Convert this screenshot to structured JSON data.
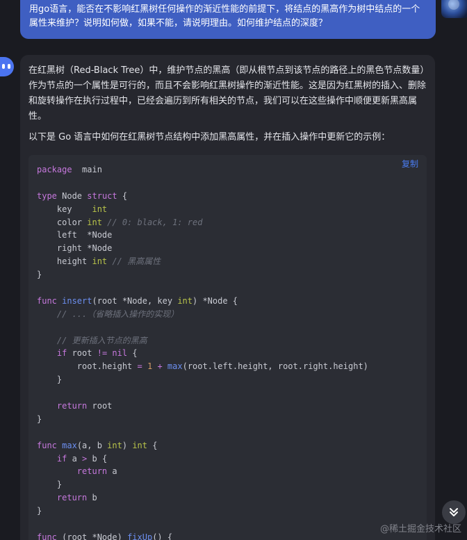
{
  "user": {
    "message": "用go语言，能否在不影响红黑树任何操作的渐近性能的前提下，将结点的黑高作为树中结点的一个属性来维护？说明如何做，如果不能，请说明理由。如何维护结点的深度？"
  },
  "assistant": {
    "paragraph1": "在红黑树（Red-Black Tree）中，维护节点的黑高（即从根节点到该节点的路径上的黑色节点数量）作为节点的一个属性是可行的，而且不会影响红黑树操作的渐近性能。这是因为红黑树的插入、删除和旋转操作在执行过程中，已经会遍历到所有相关的节点，我们可以在这些操作中顺便更新黑高属性。",
    "paragraph2": "以下是 Go 语言中如何在红黑树节点结构中添加黑高属性，并在插入操作中更新它的示例：",
    "copy_label": "复制",
    "code_lines": [
      [
        [
          "kw",
          "package"
        ],
        [
          "",
          "  main"
        ]
      ],
      [],
      [
        [
          "kw",
          "type"
        ],
        [
          "",
          " Node "
        ],
        [
          "kw",
          "struct"
        ],
        [
          "",
          " {"
        ]
      ],
      [
        [
          "",
          "    key    "
        ],
        [
          "ty",
          "int"
        ]
      ],
      [
        [
          "",
          "    color "
        ],
        [
          "ty",
          "int"
        ],
        [
          "cm",
          " // 0: black, 1: red"
        ]
      ],
      [
        [
          "",
          "    left  *Node"
        ]
      ],
      [
        [
          "",
          "    right *Node"
        ]
      ],
      [
        [
          "",
          "    height "
        ],
        [
          "ty",
          "int"
        ],
        [
          "cm",
          " // 黑高属性"
        ]
      ],
      [
        [
          "",
          "}"
        ]
      ],
      [],
      [
        [
          "kw",
          "func"
        ],
        [
          "fn",
          " insert"
        ],
        [
          "",
          "(root *Node, key "
        ],
        [
          "ty",
          "int"
        ],
        [
          "",
          ") *Node {"
        ]
      ],
      [
        [
          "cm",
          "    // ...（省略插入操作的实现）"
        ]
      ],
      [],
      [
        [
          "cm",
          "    // 更新插入节点的黑高"
        ]
      ],
      [
        [
          "",
          "    "
        ],
        [
          "kw",
          "if"
        ],
        [
          "",
          " root "
        ],
        [
          "op",
          "!="
        ],
        [
          "",
          " "
        ],
        [
          "kw",
          "nil"
        ],
        [
          "",
          " {"
        ]
      ],
      [
        [
          "",
          "        root.height "
        ],
        [
          "op",
          "="
        ],
        [
          "",
          " "
        ],
        [
          "num",
          "1"
        ],
        [
          "",
          " "
        ],
        [
          "op",
          "+"
        ],
        [
          "",
          " "
        ],
        [
          "fn",
          "max"
        ],
        [
          "",
          "(root.left.height, root.right.height)"
        ]
      ],
      [
        [
          "",
          "    }"
        ]
      ],
      [],
      [
        [
          "",
          "    "
        ],
        [
          "kw",
          "return"
        ],
        [
          "",
          " root"
        ]
      ],
      [
        [
          "",
          "}"
        ]
      ],
      [],
      [
        [
          "kw",
          "func"
        ],
        [
          "fn",
          " max"
        ],
        [
          "",
          "(a, b "
        ],
        [
          "ty",
          "int"
        ],
        [
          "",
          ") "
        ],
        [
          "ty",
          "int"
        ],
        [
          "",
          " {"
        ]
      ],
      [
        [
          "",
          "    "
        ],
        [
          "kw",
          "if"
        ],
        [
          "",
          " a "
        ],
        [
          "op",
          ">"
        ],
        [
          "",
          " b {"
        ]
      ],
      [
        [
          "",
          "        "
        ],
        [
          "kw",
          "return"
        ],
        [
          "",
          " a"
        ]
      ],
      [
        [
          "",
          "    }"
        ]
      ],
      [
        [
          "",
          "    "
        ],
        [
          "kw",
          "return"
        ],
        [
          "",
          " b"
        ]
      ],
      [
        [
          "",
          "}"
        ]
      ],
      [],
      [
        [
          "kw",
          "func"
        ],
        [
          "",
          " (root *Node) "
        ],
        [
          "fn",
          "fixUp"
        ],
        [
          "",
          "() {"
        ]
      ]
    ]
  },
  "watermark": "@稀土掘金技术社区",
  "colors": {
    "user_bubble": "#3f5fc2",
    "assistant_bubble": "#26272e",
    "code_bg": "#2b2d34",
    "accent": "#4a7cf0"
  }
}
